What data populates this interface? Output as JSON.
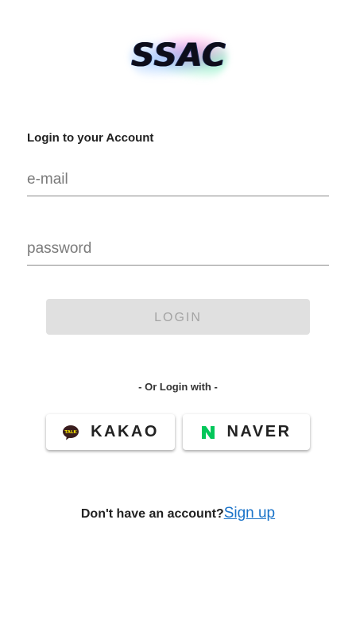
{
  "logo": {
    "text": "SSAC"
  },
  "login": {
    "title": "Login to your Account",
    "email_placeholder": "e-mail",
    "password_placeholder": "password",
    "button_label": "LOGIN"
  },
  "social": {
    "divider_text": "- Or Login with -",
    "kakao_label": "KAKAO",
    "kakao_icon": "kakao-talk-icon",
    "kakao_icon_text": "TALK",
    "naver_label": "NAVER",
    "naver_icon": "naver-n-icon",
    "naver_icon_text": "N"
  },
  "signup": {
    "prompt": "Don't have an account?",
    "link_label": "Sign up"
  },
  "colors": {
    "login_disabled_bg": "#e0e0e0",
    "link": "#1a73c9",
    "naver_green": "#03c75a",
    "kakao_bubble": "#3a1d1d"
  }
}
